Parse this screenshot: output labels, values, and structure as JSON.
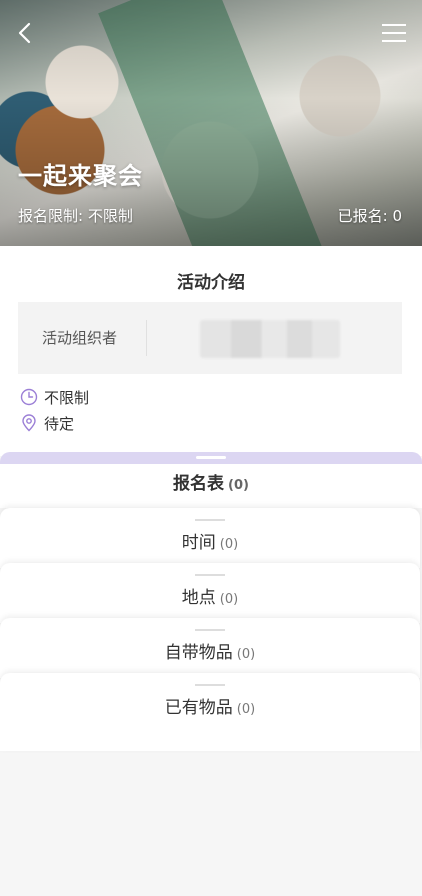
{
  "hero": {
    "title": "一起来聚会",
    "limit_text": "报名限制: 不限制",
    "enrolled_text": "已报名: 0"
  },
  "nav": {
    "back_icon": "chevron-left-icon",
    "menu_icon": "hamburger-menu-icon"
  },
  "intro": {
    "title": "活动介绍",
    "organizer_label": "活动组织者",
    "time_value": "不限制",
    "location_value": "待定"
  },
  "signup": {
    "title": "报名表",
    "count": "(0)",
    "sections": [
      {
        "label": "时间",
        "count": "(0)"
      },
      {
        "label": "地点",
        "count": "(0)"
      },
      {
        "label": "自带物品",
        "count": "(0)"
      },
      {
        "label": "已有物品",
        "count": "(0)"
      }
    ]
  },
  "colors": {
    "accent": "#9b7fd6",
    "accent_light": "#dcd6f2"
  }
}
